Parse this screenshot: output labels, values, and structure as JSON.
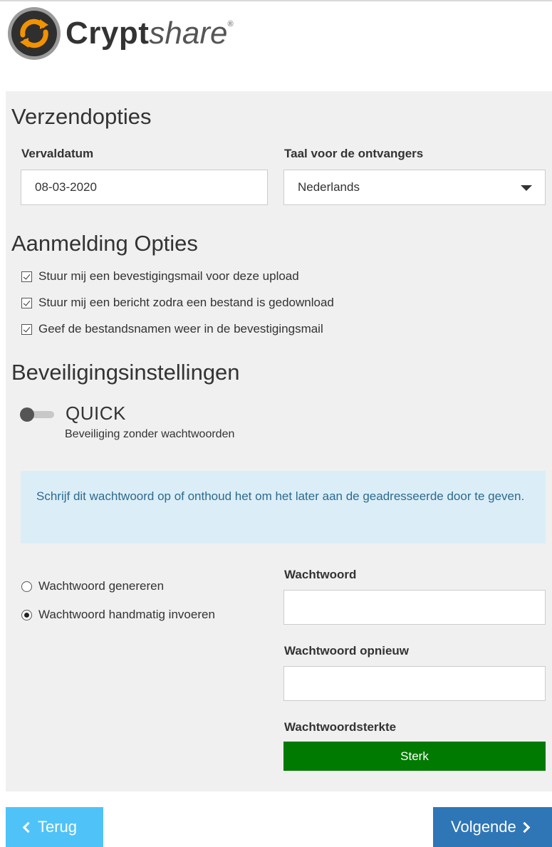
{
  "brand": {
    "name_bold": "Crypt",
    "name_italic": "share",
    "registered": "®",
    "colors": {
      "orange": "#f39200",
      "dark": "#333333"
    }
  },
  "send_options": {
    "title": "Verzendopties",
    "expiry_label": "Vervaldatum",
    "expiry_value": "08-03-2020",
    "language_label": "Taal voor de ontvangers",
    "language_value": "Nederlands"
  },
  "notification_options": {
    "title": "Aanmelding Opties",
    "items": [
      {
        "label": "Stuur mij een bevestigingsmail voor deze upload",
        "checked": true
      },
      {
        "label": "Stuur mij een bericht zodra een bestand is gedownload",
        "checked": true
      },
      {
        "label": "Geef de bestandsnamen weer in de bevestigingsmail",
        "checked": true
      }
    ]
  },
  "security": {
    "title": "Beveiligingsinstellingen",
    "quick_label": "QUICK",
    "quick_enabled": false,
    "quick_description": "Beveiliging zonder wachtwoorden",
    "info_text": "Schrijf dit wachtwoord op of onthoud het om het later aan de geadresseerde door te geven.",
    "options": [
      {
        "label": "Wachtwoord genereren",
        "selected": false
      },
      {
        "label": "Wachtwoord handmatig invoeren",
        "selected": true
      }
    ],
    "password_label": "Wachtwoord",
    "password_value": "",
    "password_repeat_label": "Wachtwoord opnieuw",
    "password_repeat_value": "",
    "strength_label": "Wachtwoordsterkte",
    "strength_value": "Sterk",
    "strength_color": "#007a00",
    "info_bg_color": "#dbeef7"
  },
  "navigation": {
    "back_label": "Terug",
    "next_label": "Volgende",
    "back_color": "#4fc3f7",
    "next_color": "#2f76b7"
  }
}
